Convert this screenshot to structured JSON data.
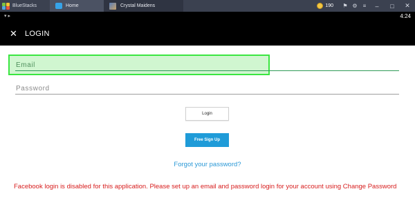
{
  "bluestacks": {
    "brand": "BlueStacks",
    "tabs": [
      {
        "label": "Home",
        "icon": "home-icon"
      },
      {
        "label": "Crystal Maidens",
        "icon": "game-icon"
      }
    ],
    "coins": "190",
    "window_controls": [
      "minimize-icon",
      "maximize-icon",
      "close-icon"
    ]
  },
  "status_bar": {
    "time": "4:24"
  },
  "app_bar": {
    "title": "LOGIN",
    "close_icon": "close-icon"
  },
  "form": {
    "email_placeholder": "Email",
    "password_placeholder": "Password",
    "login_label": "Login",
    "signup_label": "Free Sign Up",
    "forgot_label": "Forgot your password?",
    "facebook_error": "Facebook login is disabled for this application. Please set up an email and password login for your account using Change Password"
  },
  "colors": {
    "accent_green": "#2e9a57",
    "signup_blue": "#1f9bd8",
    "link_blue": "#2a98d6",
    "error_red": "#d71c1c",
    "highlight": "#3ae640"
  }
}
